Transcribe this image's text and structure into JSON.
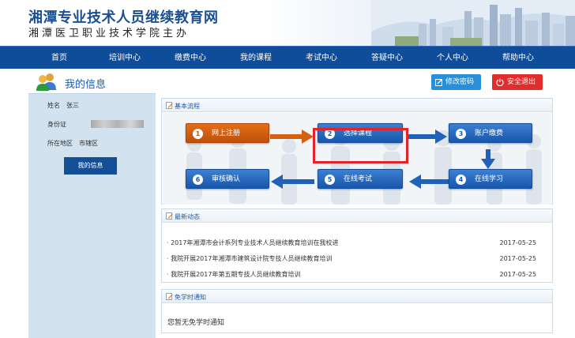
{
  "header": {
    "title": "湘潭专业技术人员继续教育网",
    "subtitle": "湘潭医卫职业技术学院主办"
  },
  "nav": {
    "items": [
      "首页",
      "培训中心",
      "缴费中心",
      "我的课程",
      "考试中心",
      "答疑中心",
      "个人中心",
      "帮助中心"
    ]
  },
  "page": {
    "title": "我的信息",
    "change_password": "修改密码",
    "logout": "安全退出"
  },
  "sidebar": {
    "name_label": "姓名",
    "name_value": "张三",
    "id_label": "身份证",
    "region_label": "所在地区",
    "region_value": "市辖区",
    "my_info_button": "我的信息"
  },
  "flow": {
    "heading": "基本流程",
    "steps": [
      {
        "num": "1",
        "label": "网上注册"
      },
      {
        "num": "2",
        "label": "选择课程"
      },
      {
        "num": "3",
        "label": "账户缴费"
      },
      {
        "num": "4",
        "label": "在线学习"
      },
      {
        "num": "5",
        "label": "在线考试"
      },
      {
        "num": "6",
        "label": "审核确认"
      }
    ]
  },
  "news": {
    "heading": "最新动态",
    "items": [
      {
        "text": "· 2017年湘潭市会计系列专业技术人员继续教育培训在我校进",
        "date": "2017-05-25"
      },
      {
        "text": "· 我院开展2017年湘潭市建筑设计院专技人员继续教育培训",
        "date": "2017-05-25"
      },
      {
        "text": "· 我院开展2017年第五期专技人员继续教育培训",
        "date": "2017-05-25"
      }
    ]
  },
  "notice": {
    "heading": "免学时通知",
    "text": "您暂无免学时通知"
  },
  "colors": {
    "nav_bg": "#0f4d9b",
    "step_blue": "#1f62b8",
    "step_orange": "#d5600f",
    "highlight": "#e3222a",
    "logout": "#e22d2d",
    "change_password": "#2b8fd8"
  }
}
